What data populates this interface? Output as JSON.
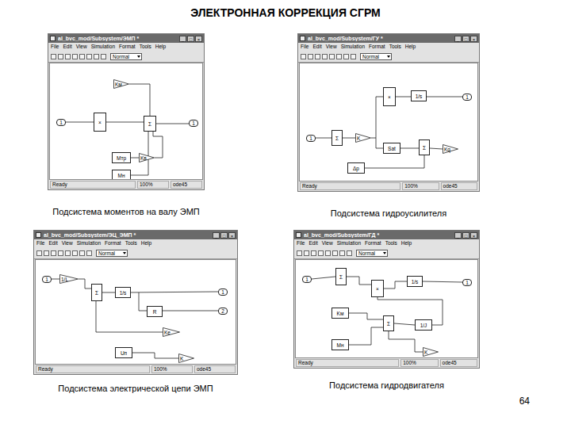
{
  "title": "ЭЛЕКТРОННАЯ КОРРЕКЦИЯ СГРМ",
  "page": "64",
  "windows": [
    {
      "title": "al_bvc_mod/Subsystem/ЭМП *",
      "controls": [
        "_",
        "□",
        "×"
      ],
      "menu": [
        "File",
        "Edit",
        "View",
        "Simulation",
        "Format",
        "Tools",
        "Help"
      ],
      "mode": "Normal",
      "status": [
        "Ready",
        "100%",
        "ode45"
      ],
      "caption": "Подсистема моментов на валу ЭМП",
      "blocks": [
        {
          "label": "1",
          "kind": "port"
        },
        {
          "label": "×",
          "kind": "block"
        },
        {
          "label": "Kм",
          "kind": "gain"
        },
        {
          "label": "Σ",
          "kind": "block"
        },
        {
          "label": "1",
          "kind": "port"
        },
        {
          "label": "Мтр",
          "kind": "block"
        },
        {
          "label": "Kв",
          "kind": "gain"
        },
        {
          "label": "Мн",
          "kind": "block"
        }
      ]
    },
    {
      "title": "al_bvc_mod/Subsystem/ГУ *",
      "controls": [
        "_",
        "□",
        "×"
      ],
      "menu": [
        "File",
        "Edit",
        "View",
        "Simulation",
        "Format",
        "Tools",
        "Help"
      ],
      "mode": "Normal",
      "status": [
        "Ready",
        "100%",
        "ode45"
      ],
      "caption": "Подсистема гидроусилителя",
      "blocks": [
        {
          "label": "1",
          "kind": "port"
        },
        {
          "label": "Σ",
          "kind": "block"
        },
        {
          "label": "K",
          "kind": "gain"
        },
        {
          "label": "×",
          "kind": "block"
        },
        {
          "label": "1/s",
          "kind": "block"
        },
        {
          "label": "1",
          "kind": "port"
        },
        {
          "label": "Sat",
          "kind": "block"
        },
        {
          "label": "Σ",
          "kind": "block"
        },
        {
          "label": "Δp",
          "kind": "block"
        },
        {
          "label": "Kq",
          "kind": "gain"
        }
      ]
    },
    {
      "title": "al_bvc_mod/Subsystem/ЭЦ_ЭМП *",
      "controls": [
        "_",
        "□",
        "×"
      ],
      "menu": [
        "File",
        "Edit",
        "View",
        "Simulation",
        "Format",
        "Tools",
        "Help"
      ],
      "mode": "Normal",
      "status": [
        "Ready",
        "100%",
        "ode45"
      ],
      "caption": "Подсистема электрической цепи ЭМП",
      "blocks": [
        {
          "label": "1",
          "kind": "port"
        },
        {
          "label": "1/L",
          "kind": "gain"
        },
        {
          "label": "Σ",
          "kind": "block"
        },
        {
          "label": "1/s",
          "kind": "block"
        },
        {
          "label": "1",
          "kind": "port"
        },
        {
          "label": "2",
          "kind": "port"
        },
        {
          "label": "R",
          "kind": "block"
        },
        {
          "label": "Ke",
          "kind": "gain"
        },
        {
          "label": "Uп",
          "kind": "block"
        },
        {
          "label": "K",
          "kind": "gain"
        }
      ]
    },
    {
      "title": "al_bvc_mod/Subsystem/ГД *",
      "controls": [
        "_",
        "□",
        "×"
      ],
      "menu": [
        "File",
        "Edit",
        "View",
        "Simulation",
        "Format",
        "Tools",
        "Help"
      ],
      "mode": "Normal",
      "status": [
        "Ready",
        "100%",
        "ode45"
      ],
      "caption": "Подсистема гидродвигателя",
      "blocks": [
        {
          "label": "1",
          "kind": "port"
        },
        {
          "label": "Σ",
          "kind": "block"
        },
        {
          "label": "×",
          "kind": "block"
        },
        {
          "label": "1/s",
          "kind": "block"
        },
        {
          "label": "1",
          "kind": "port"
        },
        {
          "label": "Kм",
          "kind": "block"
        },
        {
          "label": "Σ",
          "kind": "block"
        },
        {
          "label": "1/J",
          "kind": "block"
        },
        {
          "label": "Мн",
          "kind": "block"
        },
        {
          "label": "K",
          "kind": "gain"
        }
      ]
    }
  ]
}
